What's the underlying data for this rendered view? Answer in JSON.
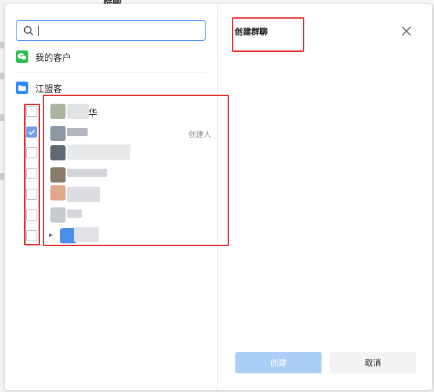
{
  "background": {
    "title": "群聊"
  },
  "search": {
    "value": "",
    "placeholder": ""
  },
  "tree": {
    "my_customers": "我的客户",
    "group": "江盟客",
    "first_member_name_tail": "华",
    "creator_tag": "创建人"
  },
  "members": [
    {
      "checked": false,
      "avatar_color": "#a9b5a0"
    },
    {
      "checked": true,
      "avatar_color": "#8d97a6"
    },
    {
      "checked": false,
      "avatar_color": "#5e6a73"
    },
    {
      "checked": false,
      "avatar_color": "#8a7a6a"
    },
    {
      "checked": false,
      "avatar_color": "#e0a88a"
    },
    {
      "checked": false,
      "avatar_color": "#c7cbd0"
    },
    {
      "checked": false,
      "avatar_color": "#4a8fe8"
    }
  ],
  "right_panel": {
    "title": "创建群聊",
    "create_label": "创建",
    "cancel_label": "取消"
  },
  "colors": {
    "accent": "#3d8bfd",
    "highlight": "#e5282a",
    "wechat_green": "#2dbb55",
    "folder_blue": "#2f87f5"
  }
}
